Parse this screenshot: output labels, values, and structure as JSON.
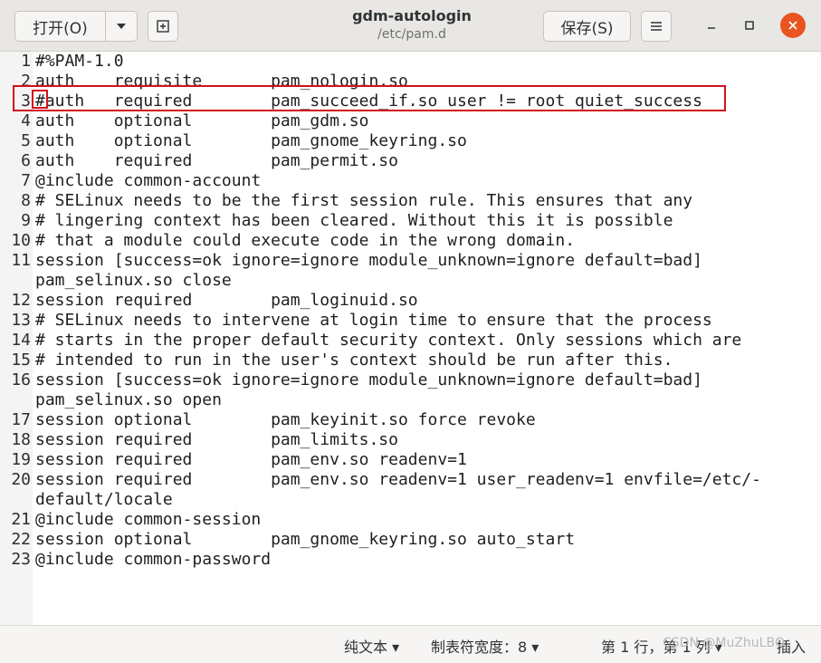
{
  "header": {
    "open_label": "打开(O)",
    "open_menu_icon": "chevron-down-icon",
    "new_tab_icon": "new-document-icon",
    "title": "gdm-autologin",
    "subtitle": "/etc/pam.d",
    "save_label": "保存(S)",
    "menu_icon": "hamburger-icon",
    "minimize_icon": "minimize-icon",
    "maximize_icon": "maximize-icon",
    "close_icon": "close-icon",
    "close_color": "#e95420"
  },
  "editor": {
    "lines": [
      {
        "n": "1",
        "text": "#%PAM-1.0"
      },
      {
        "n": "2",
        "text": "auth    requisite       pam_nologin.so"
      },
      {
        "n": "3",
        "text": "#auth   required        pam_succeed_if.so user != root quiet_success"
      },
      {
        "n": "4",
        "text": "auth    optional        pam_gdm.so"
      },
      {
        "n": "5",
        "text": "auth    optional        pam_gnome_keyring.so"
      },
      {
        "n": "6",
        "text": "auth    required        pam_permit.so"
      },
      {
        "n": "7",
        "text": "@include common-account"
      },
      {
        "n": "8",
        "text": "# SELinux needs to be the first session rule. This ensures that any"
      },
      {
        "n": "9",
        "text": "# lingering context has been cleared. Without this it is possible"
      },
      {
        "n": "10",
        "text": "# that a module could execute code in the wrong domain."
      },
      {
        "n": "11",
        "text": "session [success=ok ignore=ignore module_unknown=ignore default=bad]"
      },
      {
        "n": "",
        "text": "pam_selinux.so close"
      },
      {
        "n": "12",
        "text": "session required        pam_loginuid.so"
      },
      {
        "n": "13",
        "text": "# SELinux needs to intervene at login time to ensure that the process"
      },
      {
        "n": "14",
        "text": "# starts in the proper default security context. Only sessions which are"
      },
      {
        "n": "15",
        "text": "# intended to run in the user's context should be run after this."
      },
      {
        "n": "16",
        "text": "session [success=ok ignore=ignore module_unknown=ignore default=bad]"
      },
      {
        "n": "",
        "text": "pam_selinux.so open"
      },
      {
        "n": "17",
        "text": "session optional        pam_keyinit.so force revoke"
      },
      {
        "n": "18",
        "text": "session required        pam_limits.so"
      },
      {
        "n": "19",
        "text": "session required        pam_env.so readenv=1"
      },
      {
        "n": "20",
        "text": "session required        pam_env.so readenv=1 user_readenv=1 envfile=/etc/-"
      },
      {
        "n": "",
        "text": "default/locale"
      },
      {
        "n": "21",
        "text": "@include common-session"
      },
      {
        "n": "22",
        "text": "session optional        pam_gnome_keyring.so auto_start"
      },
      {
        "n": "23",
        "text": "@include common-password"
      }
    ],
    "highlight_color": "#d0121b"
  },
  "statusbar": {
    "syntax_label": "纯文本 ▾",
    "tab_width_label": "制表符宽度：8 ▾",
    "position_label": "第 1 行，第 1 列 ▾",
    "insert_label": "插入"
  },
  "watermark": "CSDN @MuZhuLBQ"
}
